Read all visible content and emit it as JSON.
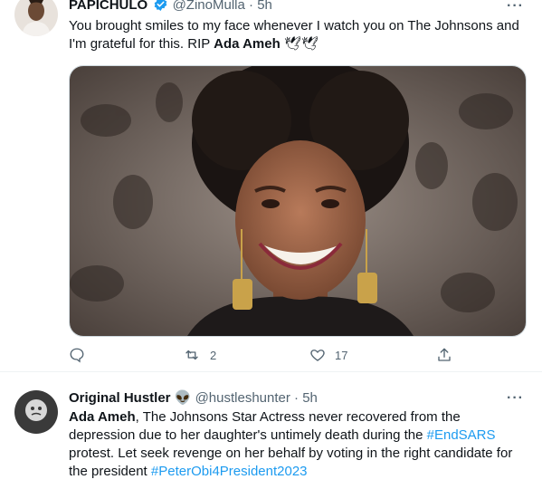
{
  "tweets": [
    {
      "display_name": "PAPICHULO",
      "handle": "@ZinoMulla",
      "sep": "·",
      "time": "5h",
      "text_parts": [
        "You brought smiles to my face whenever I watch you on The Johnsons and I'm grateful for this. RIP ",
        "Ada Ameh",
        " 🕊🕊"
      ],
      "more": "···",
      "reply_count": "",
      "retweet_count": "2",
      "like_count": "17"
    },
    {
      "display_name": "Original Hustler",
      "emoji": "👽",
      "handle": "@hustleshunter",
      "sep": "·",
      "time": "5h",
      "text_parts": [
        "Ada Ameh",
        ", The Johnsons Star Actress never recovered from the depression due to her daughter's untimely death during the ",
        "#EndSARS",
        " protest. Let seek revenge on her behalf by voting in the right candidate for the president ",
        "#PeterObi4President2023"
      ],
      "more": "···"
    }
  ],
  "colors": {
    "accent": "#1d9bf0",
    "muted": "#536471",
    "text": "#0f1419",
    "border": "#eff3f4"
  }
}
